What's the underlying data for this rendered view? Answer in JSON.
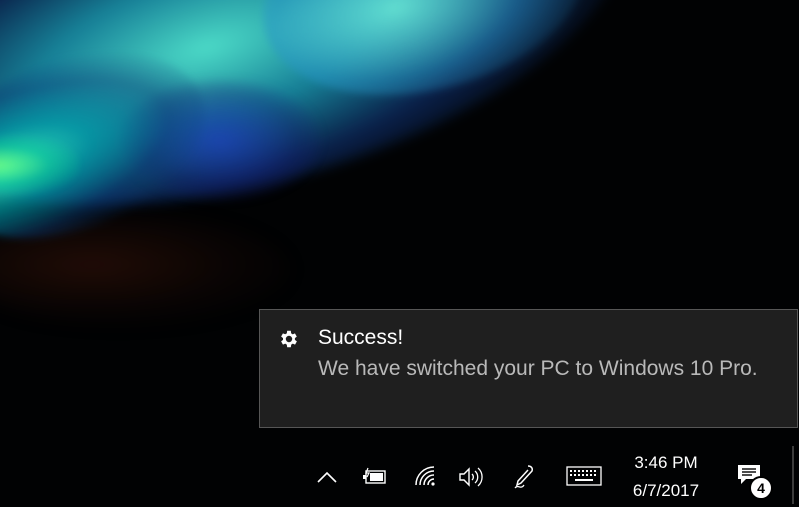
{
  "toast": {
    "icon": "gear-icon",
    "title": "Success!",
    "body": "We have switched your PC to Windows 10 Pro."
  },
  "tray": {
    "icons": [
      {
        "name": "show-hidden-icons",
        "icon": "chevron-up-icon"
      },
      {
        "name": "battery",
        "icon": "battery-charging-icon"
      },
      {
        "name": "network",
        "icon": "wifi-icon"
      },
      {
        "name": "volume",
        "icon": "speaker-icon"
      },
      {
        "name": "windows-ink",
        "icon": "pen-icon"
      },
      {
        "name": "touch-keyboard",
        "icon": "keyboard-icon"
      }
    ],
    "clock": {
      "time": "3:46 PM",
      "date": "6/7/2017"
    },
    "action_center": {
      "icon": "notifications-icon",
      "badge_count": "4"
    }
  },
  "colors": {
    "toast_background": "#1f1f1f",
    "toast_border": "#565656",
    "toast_title": "#ffffff",
    "toast_body": "#b9b9b9",
    "tray_foreground": "#ffffff"
  }
}
